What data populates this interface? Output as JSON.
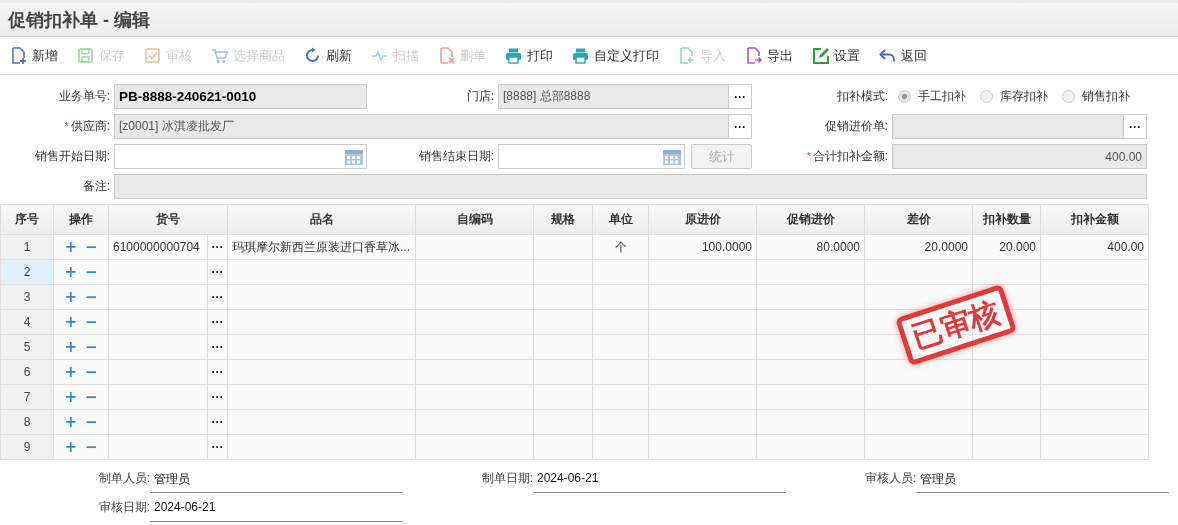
{
  "window": {
    "title": "促销扣补单 - 编辑"
  },
  "toolbar": [
    {
      "label": "新增",
      "disabled": false
    },
    {
      "label": "保存",
      "disabled": true
    },
    {
      "label": "审核",
      "disabled": true
    },
    {
      "label": "选择商品",
      "disabled": true
    },
    {
      "label": "刷新",
      "disabled": false
    },
    {
      "label": "扫描",
      "disabled": true
    },
    {
      "label": "删单",
      "disabled": true
    },
    {
      "label": "打印",
      "disabled": false
    },
    {
      "label": "自定义打印",
      "disabled": false
    },
    {
      "label": "导入",
      "disabled": true
    },
    {
      "label": "导出",
      "disabled": false
    },
    {
      "label": "设置",
      "disabled": false
    },
    {
      "label": "返回",
      "disabled": false
    }
  ],
  "form": {
    "order_no": {
      "label": "业务单号:",
      "value": "PB-8888-240621-0010"
    },
    "store": {
      "label": "门店:",
      "value": "[8888] 总部8888",
      "picker": "···"
    },
    "mode": {
      "label": "扣补模式:",
      "options": [
        {
          "label": "手工扣补",
          "selected": true
        },
        {
          "label": "库存扣补",
          "selected": false
        },
        {
          "label": "销售扣补",
          "selected": false
        }
      ]
    },
    "supplier": {
      "label": "供应商:",
      "required_mark": "*",
      "value": "[z0001]    冰淇凌批发厂",
      "picker": "···"
    },
    "price_order": {
      "label": "促销进价单:",
      "picker": "···"
    },
    "start_date": {
      "label": "销售开始日期:"
    },
    "end_date": {
      "label": "销售结束日期:"
    },
    "stat_button": {
      "label": "统计",
      "disabled": true
    },
    "total": {
      "label": "合计扣补金额:",
      "required_mark": "*",
      "value": "400.00"
    },
    "remark": {
      "label": "备注:"
    }
  },
  "table": {
    "columns": [
      "序号",
      "操作",
      "货号",
      "品名",
      "自编码",
      "规格",
      "单位",
      "原进价",
      "促销进价",
      "差价",
      "扣补数量",
      "扣补金额"
    ],
    "rows": [
      {
        "index": "1",
        "add": "+",
        "remove": "−",
        "picker": "···",
        "item_no": "6100000000704",
        "name": "玛琪摩尔新西兰原装进口香草冰...",
        "unit": "个",
        "orig_price": "100.0000",
        "promo_price": "80.0000",
        "diff": "20.0000",
        "qty": "20.000",
        "amount": "400.00",
        "selected": false
      },
      {
        "index": "2",
        "add": "+",
        "remove": "−",
        "picker": "···",
        "selected": true
      },
      {
        "index": "3",
        "add": "+",
        "remove": "−",
        "picker": "···",
        "selected": false
      },
      {
        "index": "4",
        "add": "+",
        "remove": "−",
        "picker": "···",
        "selected": false
      },
      {
        "index": "5",
        "add": "+",
        "remove": "−",
        "picker": "···",
        "selected": false
      },
      {
        "index": "6",
        "add": "+",
        "remove": "−",
        "picker": "···",
        "selected": false
      },
      {
        "index": "7",
        "add": "+",
        "remove": "−",
        "picker": "···",
        "selected": false
      },
      {
        "index": "8",
        "add": "+",
        "remove": "−",
        "picker": "···",
        "selected": false
      },
      {
        "index": "9",
        "add": "+",
        "remove": "−",
        "picker": "···",
        "selected": false
      }
    ]
  },
  "stamp": {
    "text": "已审核"
  },
  "footer": [
    {
      "label": "制单人员:",
      "value": "管理员"
    },
    {
      "label": "制单日期:",
      "value": "2024-06-21"
    },
    {
      "label": "审核人员:",
      "value": "管理员"
    },
    {
      "label": "审核日期:",
      "value": "2024-06-21"
    }
  ]
}
